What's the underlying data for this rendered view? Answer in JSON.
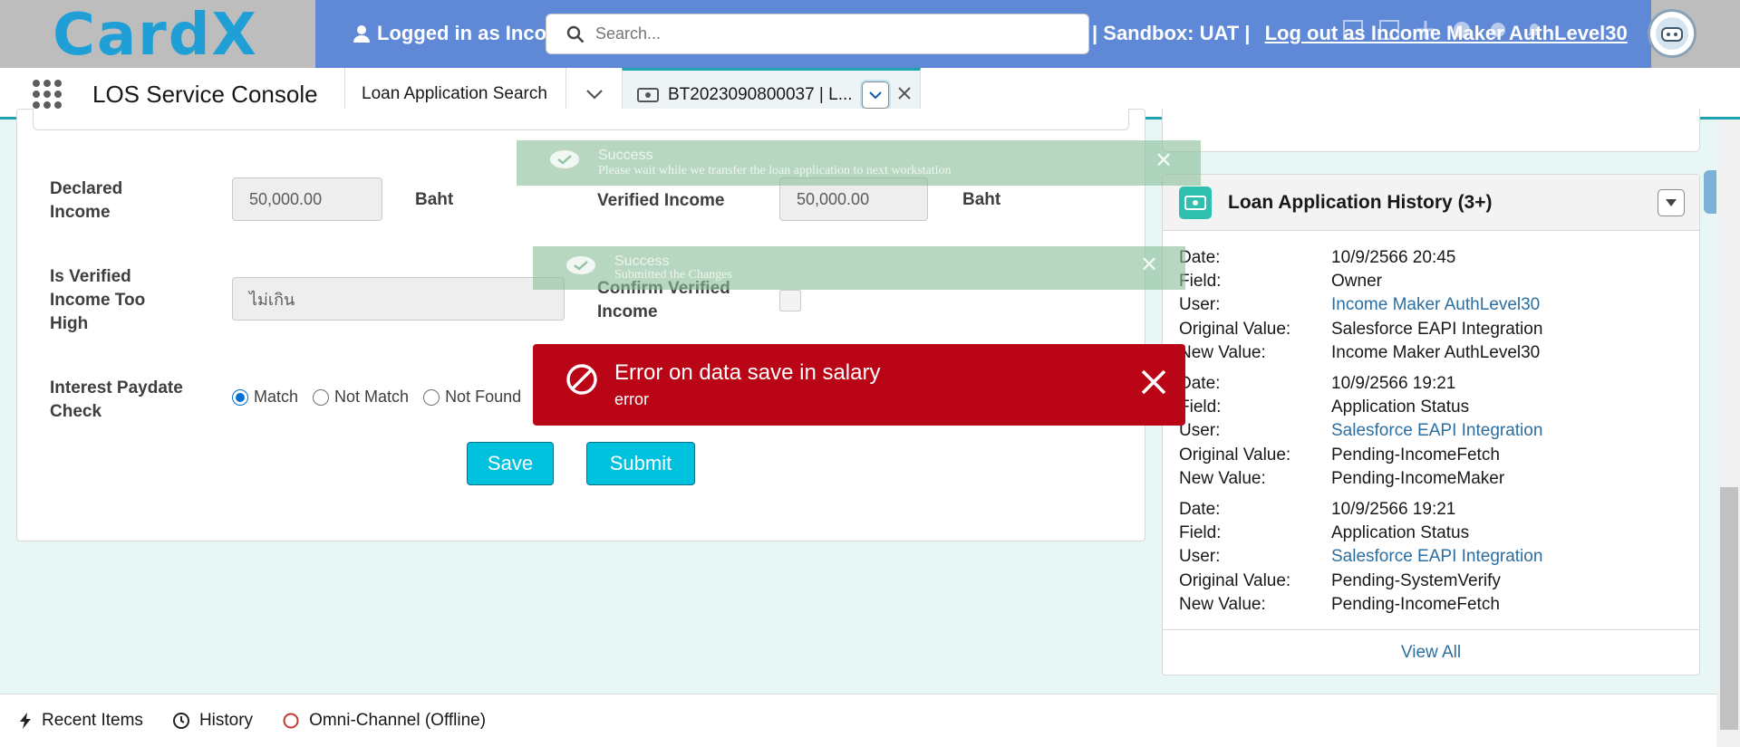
{
  "header": {
    "logo_text": "CardX",
    "logged_in_text": "Logged in as Inco",
    "sandbox_text": "| Sandbox: UAT |",
    "logout_text": "Log out as Income Maker AuthLevel30",
    "search_placeholder": "Search..."
  },
  "app_nav": {
    "app_name": "LOS Service Console",
    "tabs": [
      {
        "label": "Loan Application Search"
      },
      {
        "label": "BT2023090800037 | L..."
      }
    ]
  },
  "form": {
    "declared_income_label": "Declared Income",
    "declared_income_value": "50,000.00",
    "unit": "Baht",
    "verified_income_label": "Verified Income",
    "verified_income_value": "50,000.00",
    "too_high_label": "Is Verified Income Too High",
    "too_high_value": "ไม่เกิน",
    "confirm_verified_label": "Confirm Verified Income",
    "interest_paydate_label": "Interest Paydate Check",
    "radio_options": [
      "Match",
      "Not Match",
      "Not Found"
    ],
    "selected_radio": "Match",
    "save_label": "Save",
    "submit_label": "Submit"
  },
  "history": {
    "title": "Loan Application History (3+)",
    "keys": {
      "date": "Date:",
      "field": "Field:",
      "user": "User:",
      "original": "Original Value:",
      "new": "New Value:"
    },
    "entries": [
      {
        "date": "10/9/2566 20:45",
        "field": "Owner",
        "user": "Income Maker AuthLevel30",
        "original": "Salesforce EAPI Integration",
        "new": "Income Maker AuthLevel30"
      },
      {
        "date": "10/9/2566 19:21",
        "field": "Application Status",
        "user": "Salesforce EAPI Integration",
        "original": "Pending-IncomeFetch",
        "new": "Pending-IncomeMaker"
      },
      {
        "date": "10/9/2566 19:21",
        "field": "Application Status",
        "user": "Salesforce EAPI Integration",
        "original": "Pending-SystemVerify",
        "new": "Pending-IncomeFetch"
      }
    ],
    "view_all": "View All"
  },
  "toasts": {
    "success1": {
      "title": "Success",
      "message": "Please wait while we transfer the loan application to next workstation"
    },
    "success2": {
      "title": "Success",
      "message": "Submitted the Changes"
    },
    "error": {
      "title": "Error on data save in salary",
      "message": "error"
    }
  },
  "utility_bar": {
    "items": [
      "Recent Items",
      "History",
      "Omni-Channel (Offline)"
    ]
  },
  "colors": {
    "header_bg": "#5f88d6",
    "accent": "#00c1de",
    "error": "#ba0517",
    "link": "#2b6ea0"
  }
}
